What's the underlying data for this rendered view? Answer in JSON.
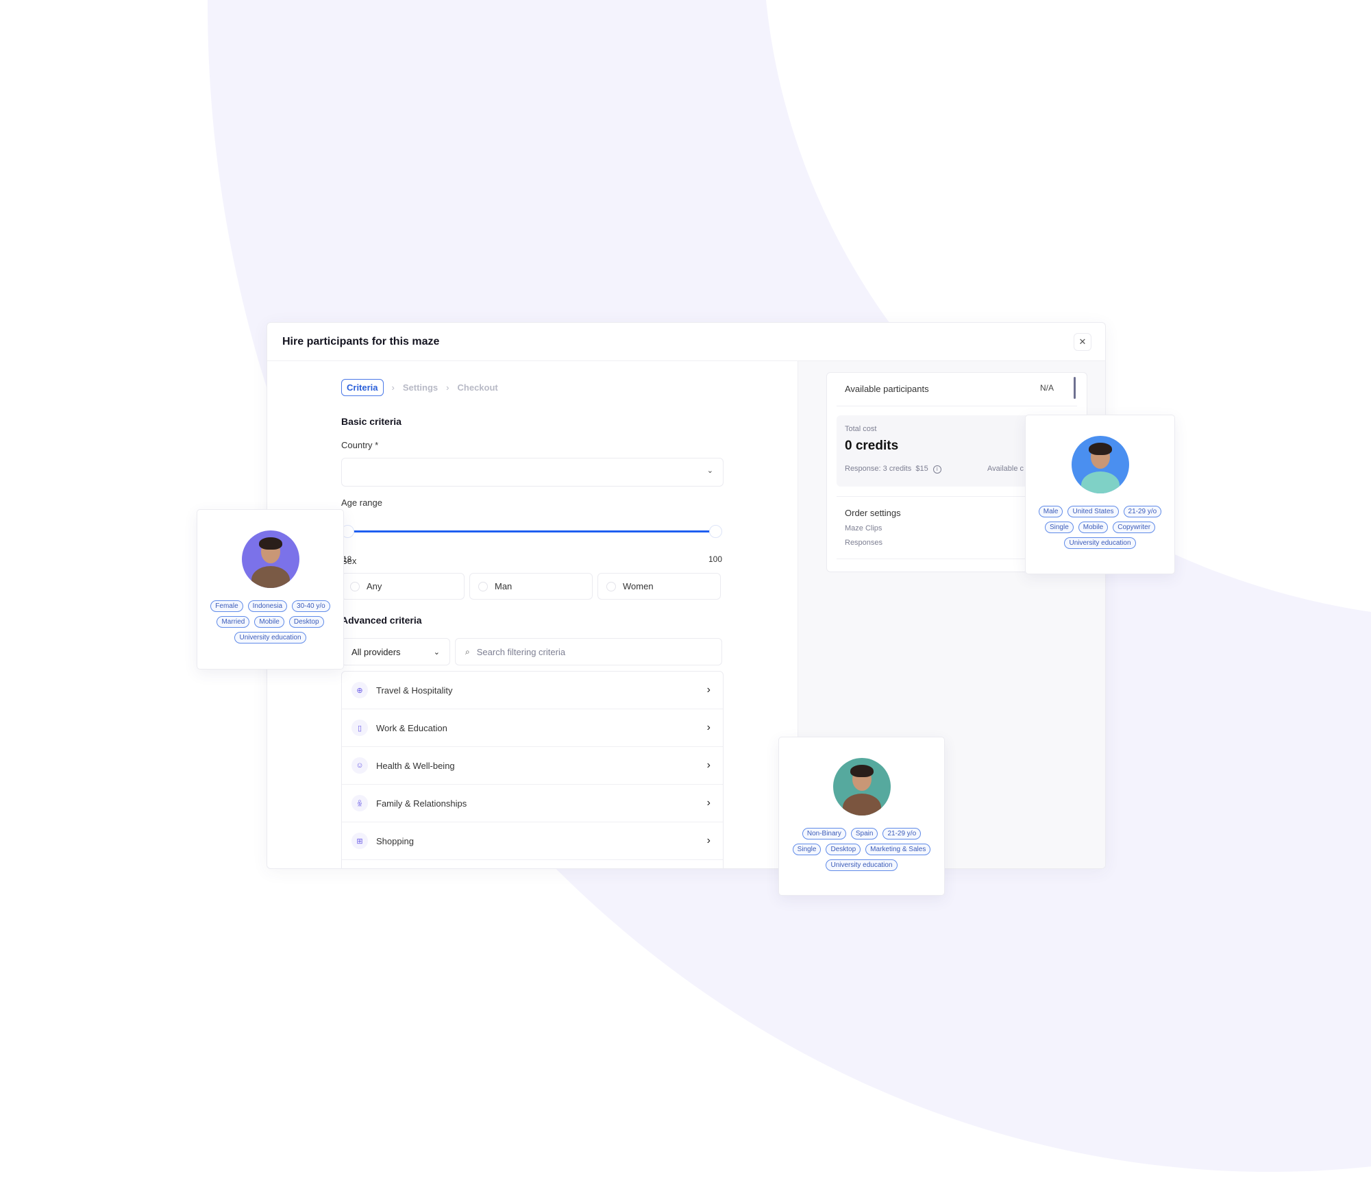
{
  "dialog": {
    "title": "Hire participants for this maze",
    "close_icon": "close-icon"
  },
  "steps": [
    {
      "label": "Criteria",
      "active": true
    },
    {
      "label": "Settings",
      "active": false
    },
    {
      "label": "Checkout",
      "active": false
    }
  ],
  "basic": {
    "title": "Basic criteria",
    "country_label": "Country *",
    "country_value": "",
    "age_label": "Age range",
    "age_min": "18",
    "age_max": "100",
    "sex_label": "Sex",
    "sex_options": [
      "Any",
      "Man",
      "Women"
    ]
  },
  "advanced": {
    "title": "Advanced criteria",
    "providers_value": "All providers",
    "search_placeholder": "Search filtering criteria",
    "categories": [
      {
        "label": "Travel & Hospitality",
        "icon": "globe-icon"
      },
      {
        "label": "Work & Education",
        "icon": "document-icon"
      },
      {
        "label": "Health & Well-being",
        "icon": "smiley-icon"
      },
      {
        "label": "Family & Relationships",
        "icon": "people-icon"
      },
      {
        "label": "Shopping",
        "icon": "gift-icon"
      }
    ]
  },
  "summary": {
    "available_label": "Available participants",
    "available_value": "N/A",
    "total_cost_label": "Total cost",
    "total_cost_value": "0 credits",
    "response_detail": "Response: 3 credits  $15",
    "available_credits_partial": "Available c",
    "order_title": "Order settings",
    "order_items": [
      "Maze Clips",
      "Responses"
    ]
  },
  "profiles": [
    {
      "name": "female-profile",
      "avatar_bg": "#7b72e9",
      "shirt": "#7a5a45",
      "tags": [
        "Female",
        "Indonesia",
        "30-40 y/o",
        "Married",
        "Mobile",
        "Desktop",
        "University education"
      ]
    },
    {
      "name": "male-profile",
      "avatar_bg": "#4a8ff0",
      "shirt": "#7fd1c6",
      "tags": [
        "Male",
        "United States",
        "21-29 y/o",
        "Single",
        "Mobile",
        "Copywriter",
        "University education"
      ]
    },
    {
      "name": "nonbinary-profile",
      "avatar_bg": "#56a99e",
      "shirt": "#7b553f",
      "tags": [
        "Non-Binary",
        "Spain",
        "21-29 y/o",
        "Single",
        "Desktop",
        "Marketing & Sales",
        "University education"
      ]
    }
  ],
  "colors": {
    "accent": "#2a5fd9",
    "background_arc": "#f4f3fd",
    "tag_border": "#5f8ae8"
  }
}
